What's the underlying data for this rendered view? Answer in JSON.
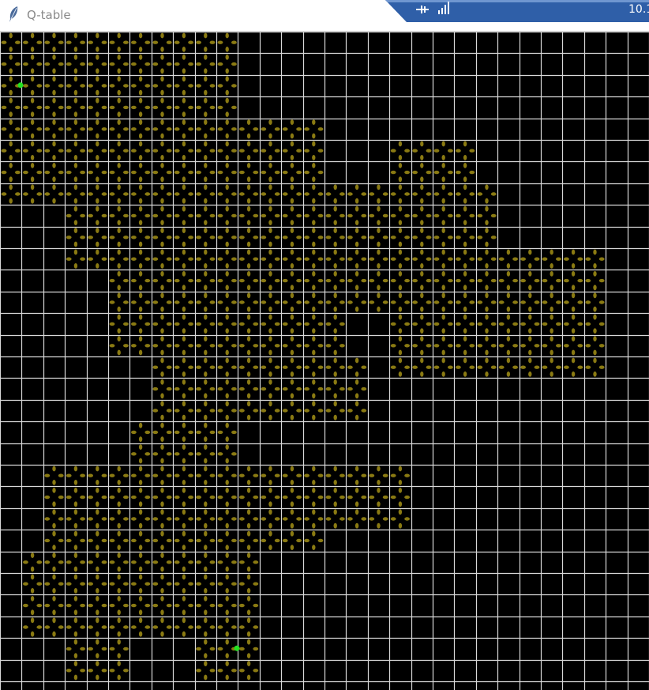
{
  "window": {
    "title": "Q-table",
    "app_icon": "feather-icon"
  },
  "tray": {
    "clock": "10.1",
    "icons": [
      "pin-icon",
      "signal-icon"
    ]
  },
  "colors": {
    "background": "#000000",
    "grid_line": "#d8d8d8",
    "arrow": "#8a7a12",
    "agent": "#22e022",
    "tray_bg": "#2f5fa8",
    "titlebar_bg": "#ffffff"
  },
  "grid": {
    "columns": 30,
    "rows": 30
  },
  "markers": [
    {
      "name": "start",
      "col": 0,
      "row": 2
    },
    {
      "name": "goal",
      "col": 10,
      "row": 28
    }
  ]
}
